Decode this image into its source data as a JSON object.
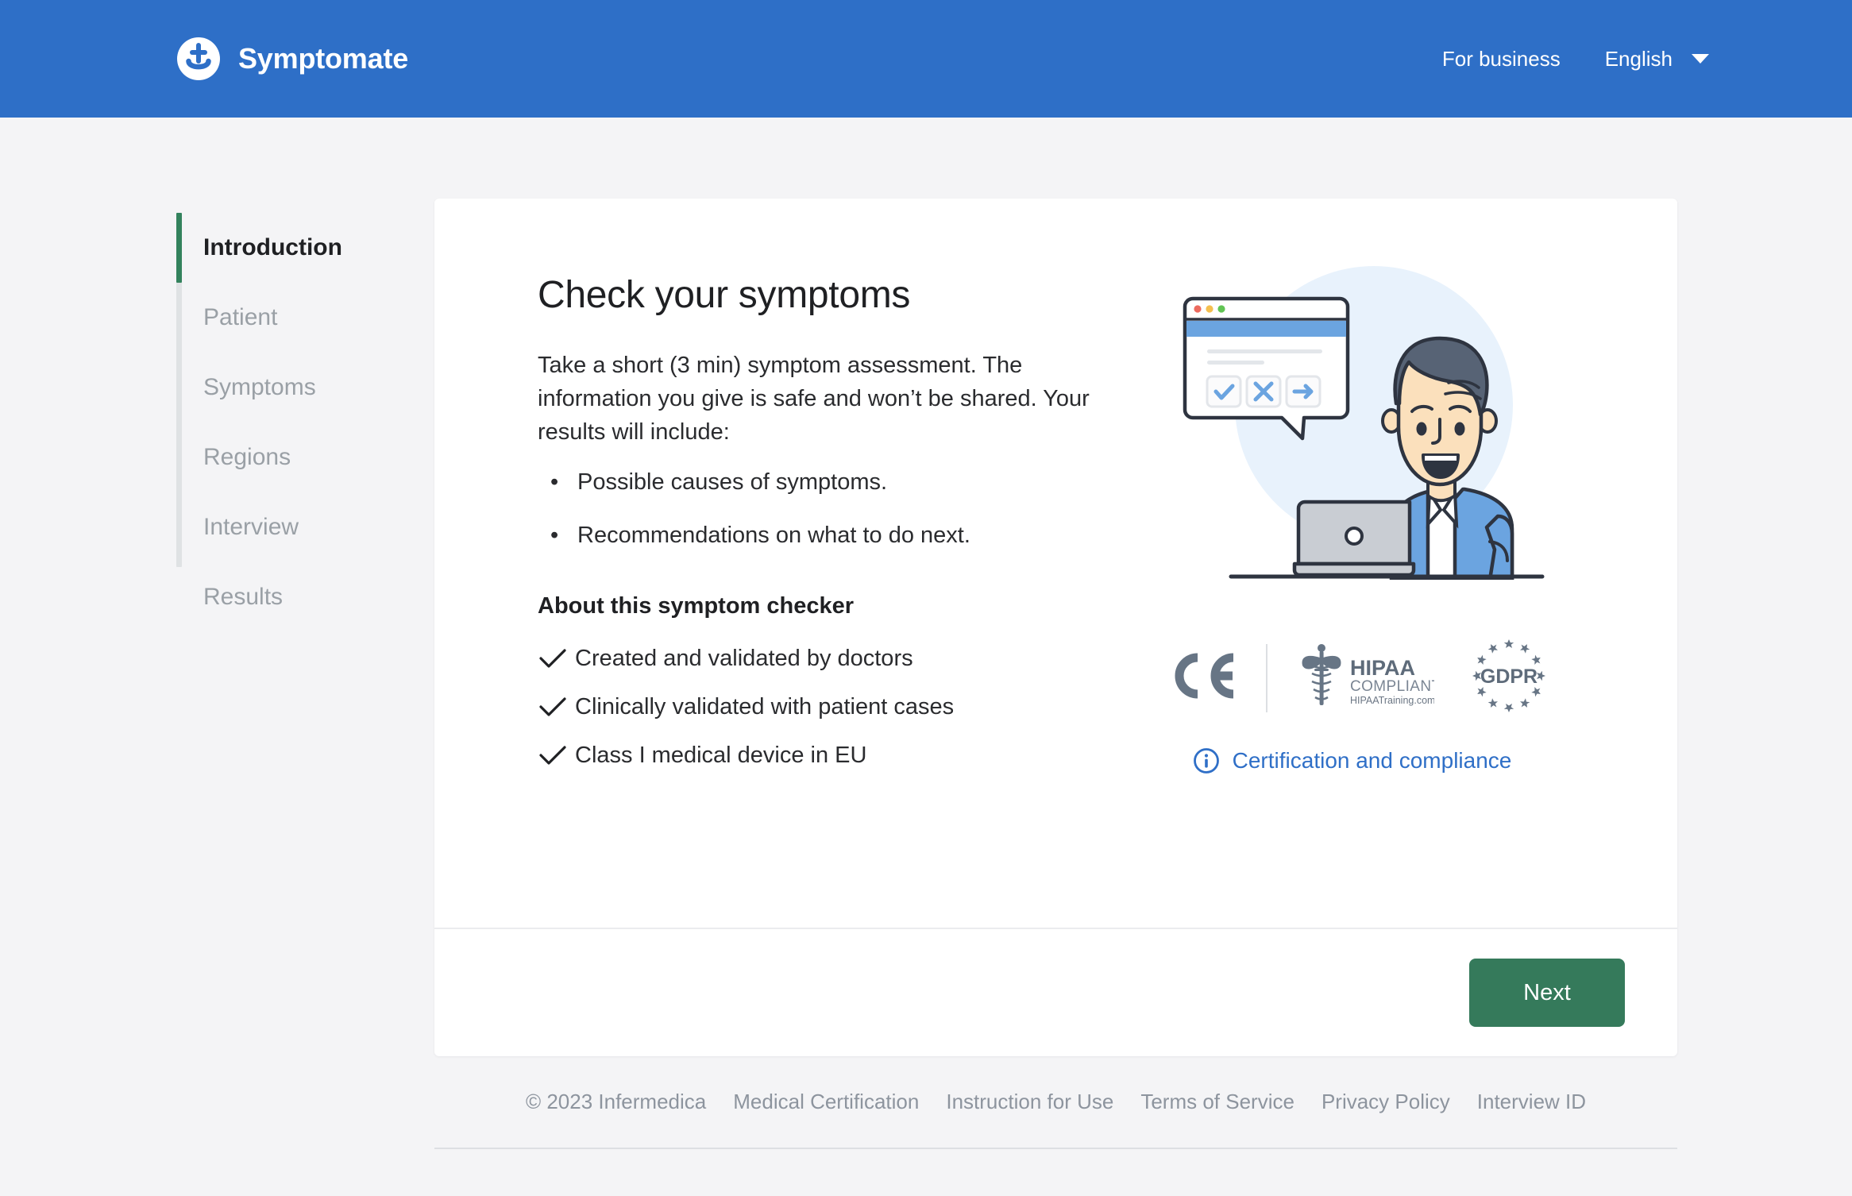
{
  "header": {
    "brand_name": "Symptomate",
    "brand_logo_icon": "symptomate-logo-icon",
    "business_link": "For business",
    "language": "English",
    "caret_icon": "chevron-down-icon",
    "background_color": "#2e6fc7"
  },
  "stepper": {
    "active_color": "#33825d",
    "rail_color": "#dfe2e4",
    "steps": [
      {
        "label": "Introduction",
        "active": true
      },
      {
        "label": "Patient",
        "active": false
      },
      {
        "label": "Symptoms",
        "active": false
      },
      {
        "label": "Regions",
        "active": false
      },
      {
        "label": "Interview",
        "active": false
      },
      {
        "label": "Results",
        "active": false
      }
    ]
  },
  "main": {
    "title": "Check your symptoms",
    "intro_paragraph": "Take a short (3 min) symptom assessment. The information you give is safe and won’t be shared. Your results will include:",
    "result_items": [
      "Possible causes of symptoms.",
      "Recommendations on what to do next."
    ],
    "about_heading": "About this symptom checker",
    "about_items": [
      "Created and validated by doctors",
      "Clinically validated with patient cases",
      "Class I medical device in EU"
    ],
    "check_icon": "check-icon",
    "bullet_icon": "bullet-dot-icon"
  },
  "illustration": {
    "name": "person-at-laptop-illustration",
    "circle_color": "#e8f2fc",
    "bubble_buttons": [
      "check-icon",
      "close-icon",
      "arrow-right-icon"
    ],
    "traffic_lights": [
      "#ec6a5e",
      "#f4bf4f",
      "#61c454"
    ],
    "shirt_color": "#6ba4e0",
    "hair_color": "#576375",
    "skin_color": "#fbe0bc",
    "laptop_color": "#c9cdd3"
  },
  "badges": {
    "ce": {
      "name": "ce-mark-badge",
      "label": "CE"
    },
    "hipaa": {
      "name": "hipaa-compliant-badge",
      "line1": "HIPAA",
      "line2": "COMPLIANT",
      "line3": "HIPAATraining.com",
      "icon": "caduceus-icon"
    },
    "gdpr": {
      "name": "gdpr-badge",
      "label": "GDPR",
      "stars": 12
    },
    "badge_color": "#677585",
    "certification_link": "Certification and compliance",
    "info_icon": "info-circle-icon",
    "link_color": "#2f6fc7"
  },
  "card_footer": {
    "next_label": "Next",
    "next_color": "#357a5b"
  },
  "site_footer": {
    "copyright": "© 2023 Infermedica",
    "links": [
      "Medical Certification",
      "Instruction for Use",
      "Terms of Service",
      "Privacy Policy",
      "Interview ID"
    ]
  }
}
